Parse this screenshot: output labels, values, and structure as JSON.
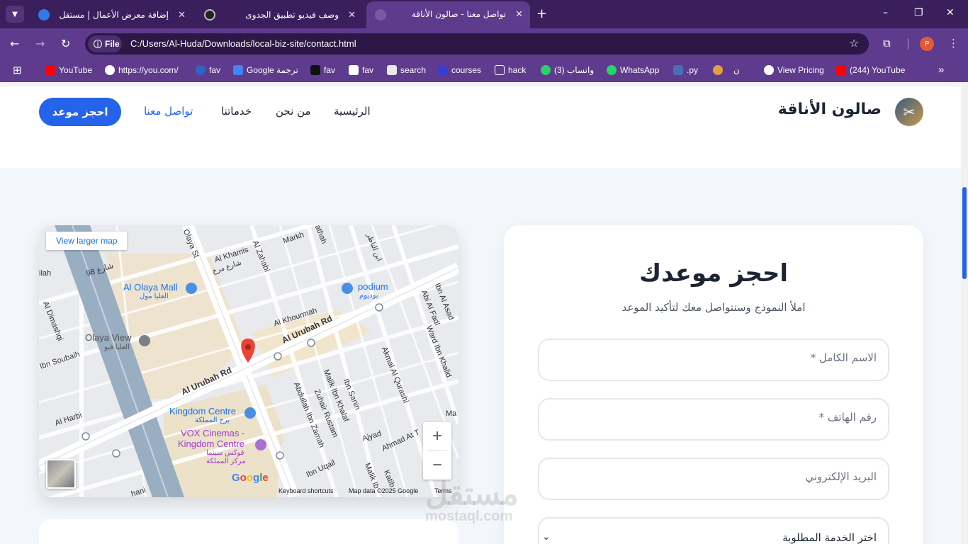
{
  "browser": {
    "tabs": [
      {
        "title": "إضافة معرض الأعمال | مستقل",
        "active": false
      },
      {
        "title": "وصف فيديو تطبيق الجدوى",
        "active": false
      },
      {
        "title": "تواصل معنا - صالون الأناقة",
        "active": true
      }
    ],
    "new_tab": "+",
    "window_controls": {
      "minimize": "–",
      "restore": "❐",
      "close": "✕"
    },
    "nav": {
      "back": "←",
      "forward": "→",
      "reload": "↻"
    },
    "address": {
      "chip_label": "File",
      "url": "C:/Users/Al-Huda/Downloads/local-biz-site/contact.html"
    },
    "profile_initial": "P",
    "bookmarks": [
      {
        "label": "YouTube",
        "icon": "youtube-icon"
      },
      {
        "label": "https://you.com/",
        "icon": "you-icon"
      },
      {
        "label": "fav",
        "icon": "bookmark-icon"
      },
      {
        "label": "Google ترجمة",
        "icon": "translate-icon"
      },
      {
        "label": "fav",
        "icon": "bookmark-icon"
      },
      {
        "label": "fav",
        "icon": "bookmark-icon"
      },
      {
        "label": "search",
        "icon": "search-icon"
      },
      {
        "label": "courses",
        "icon": "courses-icon"
      },
      {
        "label": "hack",
        "icon": "folder-icon"
      },
      {
        "label": "(3) واتساب",
        "icon": "whatsapp-icon"
      },
      {
        "label": "WhatsApp",
        "icon": "whatsapp-icon"
      },
      {
        "label": ".py",
        "icon": "python-icon"
      },
      {
        "label": "ن",
        "icon": "bookmark-icon"
      },
      {
        "label": "View Pricing",
        "icon": "globe-icon"
      },
      {
        "label": "(244) YouTube",
        "icon": "youtube-icon"
      }
    ],
    "more_bookmarks": "»"
  },
  "site": {
    "logo_text": "صالون الأناقة",
    "nav": {
      "home": "الرئيسية",
      "about": "من نحن",
      "services": "خدماتنا",
      "contact": "تواصل معنا"
    },
    "cta": "احجز موعد"
  },
  "map": {
    "view_larger": "View larger map",
    "zoom_in": "+",
    "zoom_out": "−",
    "google": "Google",
    "keyboard_shortcuts": "Keyboard shortcuts",
    "map_data": "Map data ©2025 Google",
    "terms": "Terms",
    "labels": {
      "olaya_st": "Olaya St",
      "al_khamis": "Al Khamis",
      "street_murkh": "شارع مرخ",
      "al_zahabi": "Al Zahabi",
      "markh": "Markh",
      "athah": "athah",
      "street_98": "شارع 98",
      "ilah": "ilah",
      "olaya_mall": "Al Olaya Mall",
      "olaya_mall_ar": "العليا مول",
      "podium": "podium",
      "podium_ar": "بوديوم",
      "al_khourmah": "Al Khourmah",
      "al_urubah_rd_1": "Al Urubah Rd",
      "al_urubah_rd_2": "Al Urubah Rd",
      "al_dimashqi": "Al Dimashqi",
      "olaya_view": "Olaya View",
      "olaya_view_ar": "العليا فيو",
      "ibn_soubaih": "Ibn Soubaih",
      "ibn_al_asad": "Ibn Al Asad",
      "abi_al_fadl": "Abi Al Fadl",
      "ward_ibn_khalid": "Ward Ibn Khalid",
      "akmal": "Akmal Al Qurashi",
      "malik_khalaf": "Malik Ibn Khalaf",
      "ibn_sanin": "Ibn Sanin",
      "abdullah_zamah": "Abdullah Ibn Zamah",
      "zuhair_rustam": "Zuhair Rustam",
      "kingdom_centre": "Kingdom Centre",
      "kingdom_centre_ar": "برج المملكة",
      "al_harbi": "Al Harbi",
      "vox": "VOX Cinemas -",
      "vox2": "Kingdom Centre",
      "vox_ar": "فوكس سينما",
      "vox_ar2": "مركز المملكة",
      "ajyad": "Ajyad",
      "ahmad_at": "Ahmad At T",
      "ibn_uqail": "Ibn Uqail",
      "malik_ib": "Malik Ib",
      "katib": "Katib",
      "ma": "Ma",
      "hani": "hani",
      "ibn_al_nathr": "ابن الناظر"
    }
  },
  "form": {
    "title": "احجز موعدك",
    "subtitle": "املأ النموذج وسنتواصل معك لتأكيد الموعد",
    "name_placeholder": "الاسم الكامل *",
    "phone_placeholder": "رقم الهاتف *",
    "email_placeholder": "البريد الإلكتروني",
    "service_placeholder": "اختر الخدمة المطلوبة"
  },
  "watermark": {
    "ar": "مستقل",
    "en": "mostaql.com"
  },
  "colors": {
    "accent": "#2563eb",
    "browser_dark": "#3b1f5c",
    "browser_toolbar": "#5f3b8d",
    "page_bg": "#f3f6fa"
  }
}
